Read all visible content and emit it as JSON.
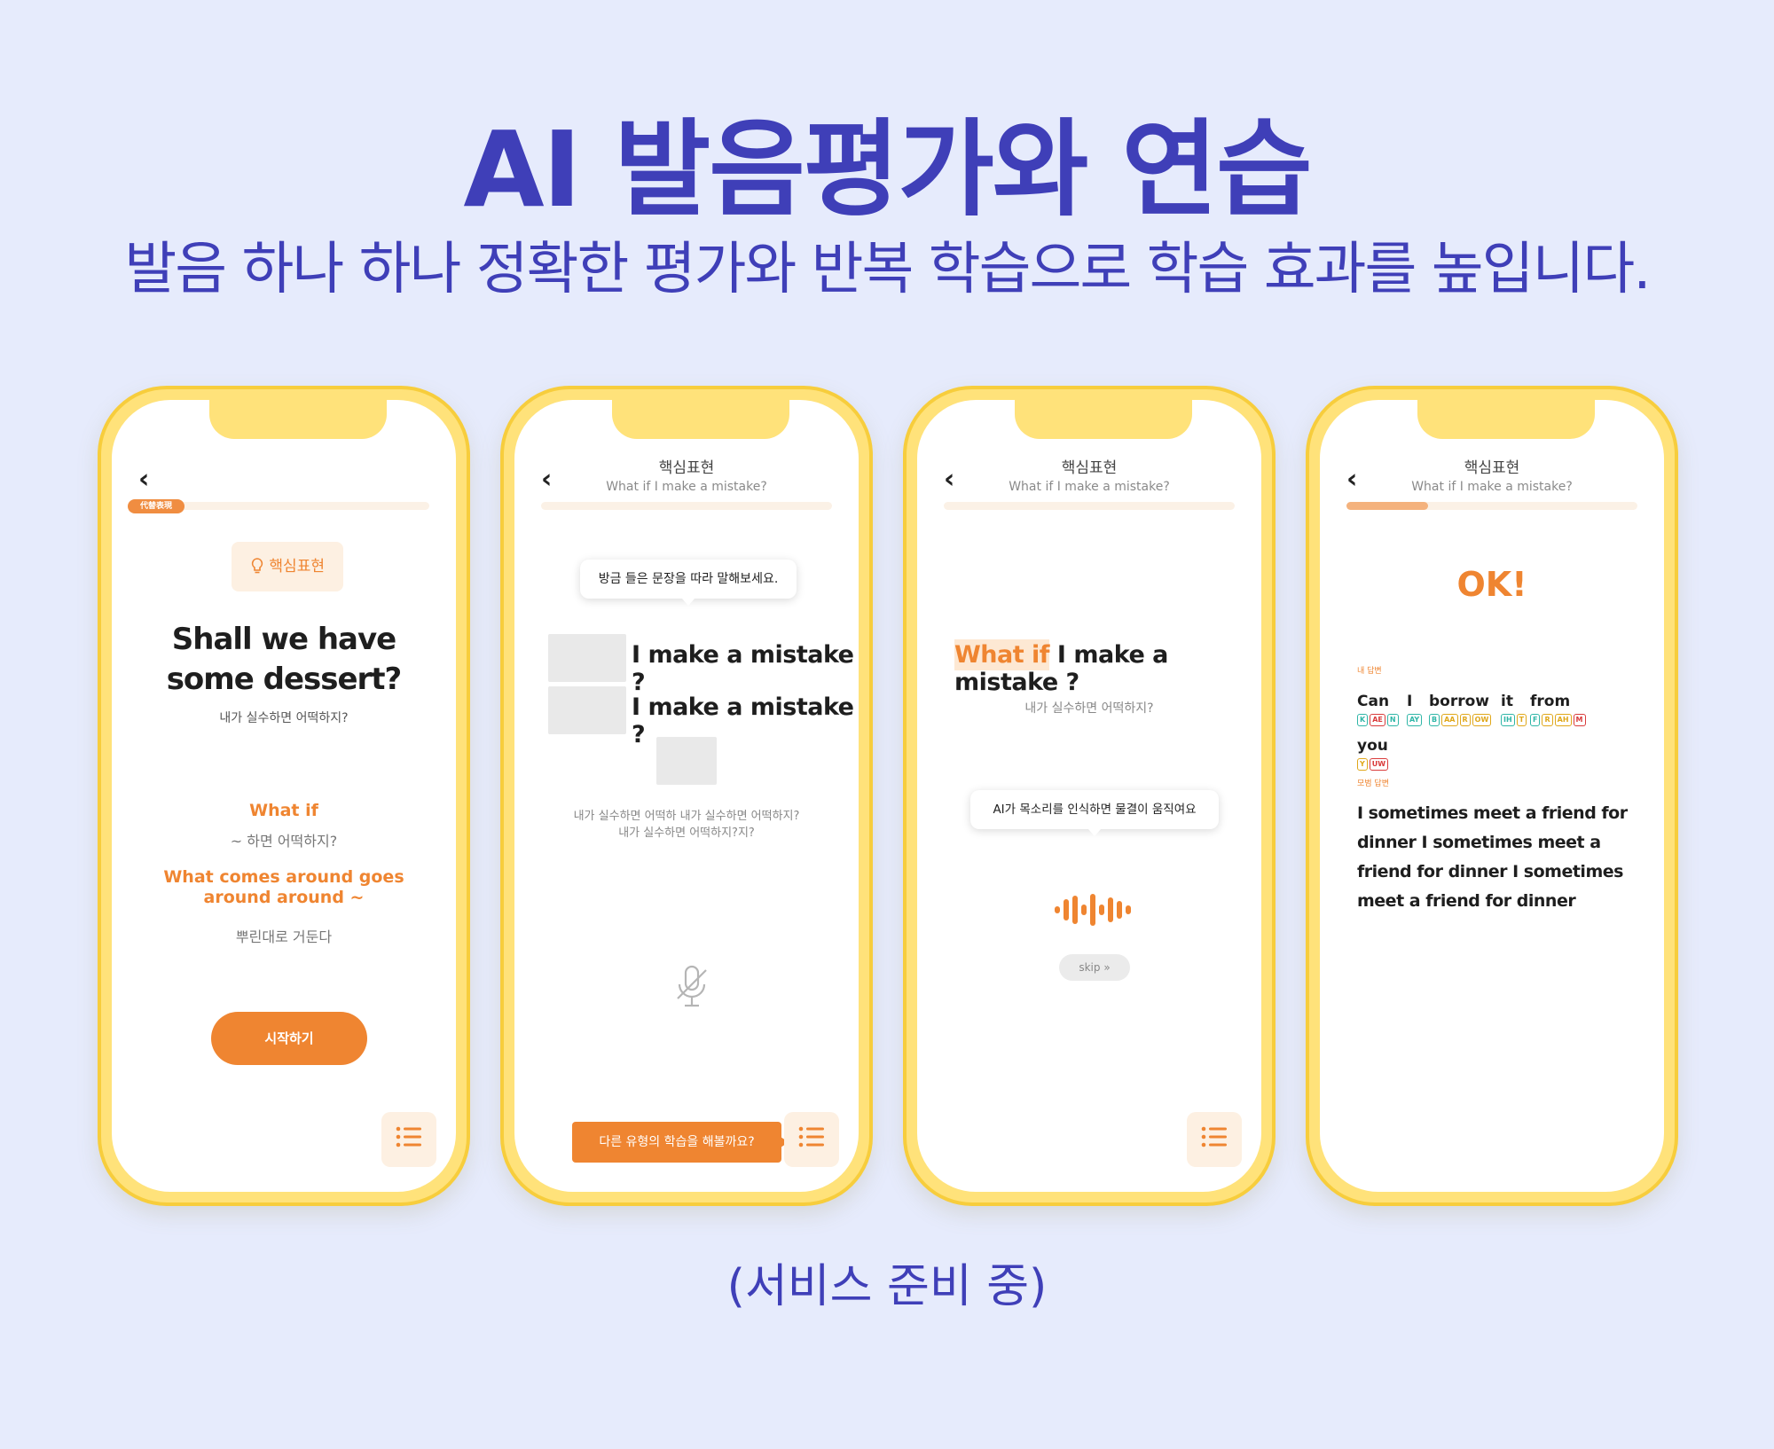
{
  "headline": "AI 발음평가와 연습",
  "subline": "발음 하나 하나 정확한 평가와 반복 학습으로 학습 효과를 높입니다.",
  "footer_note": "(서비스 준비 중)",
  "colors": {
    "background": "#e6ebfc",
    "heading": "#3f3fb8",
    "accent": "#ef8531",
    "phone_frame": "#ffe27a"
  },
  "phone1": {
    "tag": "代替表現",
    "core_label": "핵심표현",
    "sentence_line1": "Shall we have",
    "sentence_line2": "some dessert?",
    "translation": "내가 실수하면 어떡하지?",
    "expr1": "What if",
    "expr1_meaning": "~ 하면 어떡하지?",
    "expr2": "What comes around goes around around ~",
    "expr2_meaning": "뿌린대로 거둔다",
    "start_button": "시작하기",
    "icons": {
      "back": "chevron-left-icon",
      "core": "lightbulb-icon",
      "menu": "list-icon"
    }
  },
  "phone2": {
    "title": "핵심표현",
    "subtitle": "What if I make a mistake?",
    "bubble": "방금 들은 문장을 따라 말해보세요.",
    "sentence1": "I make a mistake ?",
    "sentence2": "I make a mistake ?",
    "translation_line1": "내가 실수하면 어떡하 내가 실수하면 어떡하지?",
    "translation_line2": "내가 실수하면 어떡하지?지?",
    "cta": "다른 유형의 학습을 해볼까요?",
    "icons": {
      "mic": "mic-off-icon"
    }
  },
  "phone3": {
    "title": "핵심표현",
    "subtitle": "What if I make a mistake?",
    "highlight": "What if",
    "sentence_rest": " I make a mistake ?",
    "translation": "내가 실수하면 어떡하지?",
    "bubble": "AI가 목소리를 인식하면 물결이 움직여요",
    "skip": "skip",
    "icons": {
      "wave": "sound-wave-icon",
      "skip": "chevrons-down-icon"
    }
  },
  "phone4": {
    "title": "핵심표현",
    "subtitle": "What if I make a mistake?",
    "progress": 0.28,
    "result": "OK!",
    "my_answer_label": "내 답변",
    "model_answer_label": "모범 답변",
    "words": [
      {
        "text": "Can",
        "phonemes": [
          {
            "p": "K",
            "c": "g"
          },
          {
            "p": "AE",
            "c": "r"
          },
          {
            "p": "N",
            "c": "g"
          }
        ]
      },
      {
        "text": "I",
        "phonemes": [
          {
            "p": "AY",
            "c": "g"
          }
        ]
      },
      {
        "text": "borrow",
        "phonemes": [
          {
            "p": "B",
            "c": "g"
          },
          {
            "p": "AA",
            "c": "y"
          },
          {
            "p": "R",
            "c": "y"
          },
          {
            "p": "OW",
            "c": "y"
          }
        ]
      },
      {
        "text": "it",
        "phonemes": [
          {
            "p": "IH",
            "c": "g"
          },
          {
            "p": "T",
            "c": "y"
          }
        ]
      },
      {
        "text": "from",
        "phonemes": [
          {
            "p": "F",
            "c": "g"
          },
          {
            "p": "R",
            "c": "y"
          },
          {
            "p": "AH",
            "c": "y"
          },
          {
            "p": "M",
            "c": "r"
          }
        ]
      },
      {
        "text": "you",
        "phonemes": [
          {
            "p": "Y",
            "c": "y"
          },
          {
            "p": "UW",
            "c": "r"
          }
        ]
      }
    ],
    "model_answer": "I sometimes meet a friend for dinner I sometimes meet a friend for dinner I sometimes meet a friend for dinner"
  }
}
